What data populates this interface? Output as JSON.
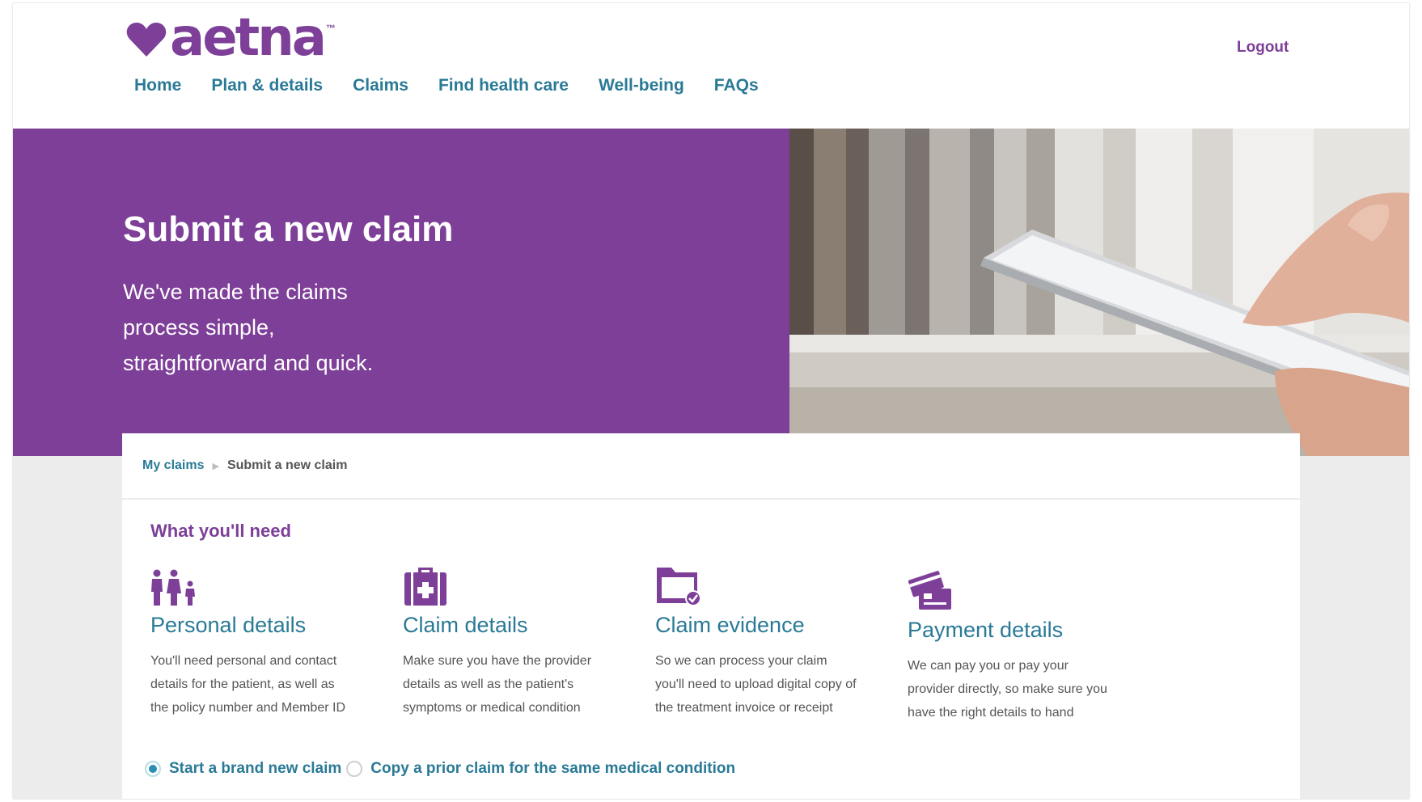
{
  "header": {
    "logo_text": "aetna",
    "logo_tm": "™",
    "logout_label": "Logout",
    "nav": [
      "Home",
      "Plan & details",
      "Claims",
      "Find health care",
      "Well-being",
      "FAQs"
    ]
  },
  "hero": {
    "title": "Submit a new claim",
    "subtitle": "We've made the claims process simple, straightforward and quick."
  },
  "breadcrumb": {
    "parent": "My claims",
    "current": "Submit a new claim"
  },
  "needs": {
    "heading": "What you'll need",
    "items": [
      {
        "icon": "family-icon",
        "title": "Personal details",
        "text": "You'll need personal and contact details for the patient, as well as the policy number and Member ID"
      },
      {
        "icon": "medical-kit-icon",
        "title": "Claim details",
        "text": "Make sure you have the provider details as well as the patient's symptoms or medical condition"
      },
      {
        "icon": "folder-check-icon",
        "title": "Claim evidence",
        "text": "So we can process your claim you'll need to upload digital copy of the treatment invoice or receipt"
      },
      {
        "icon": "payment-cards-icon",
        "title": "Payment details",
        "text": "We can pay you or pay your provider directly, so make sure you have the right details to hand"
      }
    ]
  },
  "claim_type": {
    "selected": "Start a brand new claim",
    "options": [
      "Start a brand new claim",
      "Copy a prior claim for the same medical condition"
    ]
  },
  "colors": {
    "brand_purple": "#7d3f98",
    "link_teal": "#2a7a96",
    "background_gray": "#ececec"
  }
}
